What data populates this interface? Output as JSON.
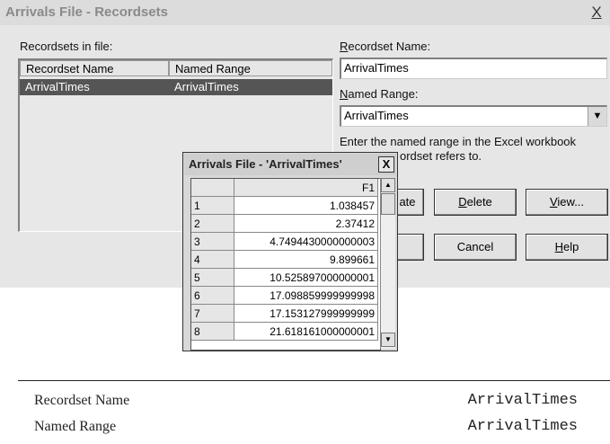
{
  "window": {
    "title": "Arrivals File - Recordsets",
    "close_glyph": "X"
  },
  "recordsets_label": "Recordsets in file:",
  "list": {
    "columns": [
      "Recordset Name",
      "Named Range"
    ],
    "rows": [
      [
        "ArrivalTimes",
        "ArrivalTimes"
      ]
    ]
  },
  "recordset_name": {
    "label": "Recordset Name:",
    "value": "ArrivalTimes"
  },
  "named_range": {
    "label": "Named Range:",
    "value": "ArrivalTimes"
  },
  "hint": {
    "line1": "Enter the named range in the Excel workbook",
    "line2": "ordset refers to."
  },
  "buttons": {
    "partial_label": "ate",
    "delete": "Delete",
    "view": "View...",
    "cancel": "Cancel",
    "help": "Help"
  },
  "preview": {
    "title": "Arrivals File - 'ArrivalTimes'",
    "close_glyph": "X",
    "column_header": "F1",
    "rows": [
      {
        "n": "1",
        "v": "1.038457"
      },
      {
        "n": "2",
        "v": "2.37412"
      },
      {
        "n": "3",
        "v": "4.7494430000000003"
      },
      {
        "n": "4",
        "v": "9.899661"
      },
      {
        "n": "5",
        "v": "10.525897000000001"
      },
      {
        "n": "6",
        "v": "17.098859999999998"
      },
      {
        "n": "7",
        "v": "17.153127999999999"
      },
      {
        "n": "8",
        "v": "21.618161000000001"
      }
    ]
  },
  "summary": [
    {
      "label": "Recordset Name",
      "value": "ArrivalTimes"
    },
    {
      "label": "Named Range",
      "value": "ArrivalTimes"
    }
  ]
}
